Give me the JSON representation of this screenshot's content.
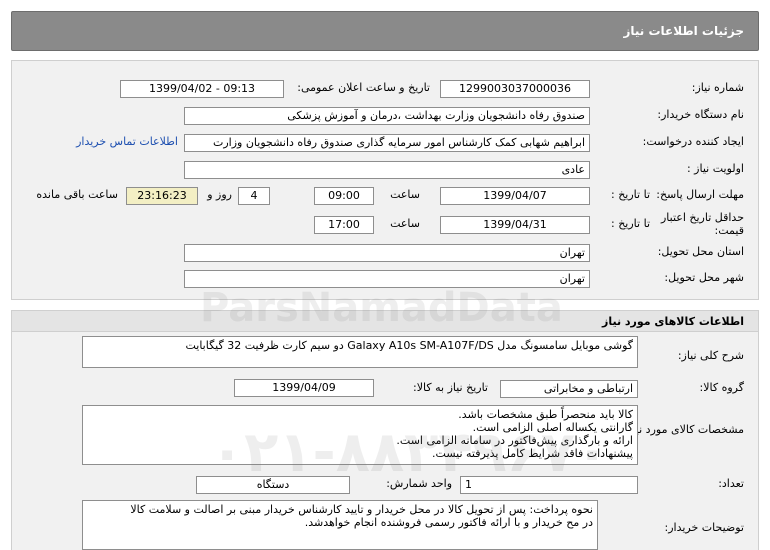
{
  "page": {
    "title": "جزئیات اطلاعات نیاز"
  },
  "need": {
    "number_label": "شماره نیاز:",
    "number": "1299003037000036",
    "announce_label": "تاریخ و ساعت اعلان عمومی:",
    "announce_value": "1399/04/02 - 09:13",
    "buyer_label": "نام دستگاه خریدار:",
    "buyer": "صندوق رفاه دانشجویان وزارت بهداشت ،درمان و آموزش پزشکی",
    "creator_label": "ایجاد کننده درخواست:",
    "creator": "ابراهیم شهابی کمک کارشناس امور سرمایه گذاری صندوق رفاه دانشجویان وزارت",
    "contact_link": "اطلاعات تماس خریدار",
    "priority_label": "اولویت نیاز :",
    "priority": "عادی",
    "deadline_label": "مهلت ارسال پاسخ:",
    "until_date_label": "تا تاریخ :",
    "deadline_date": "1399/04/07",
    "time_label": "ساعت",
    "deadline_time": "09:00",
    "days": "4",
    "days_label": "روز و",
    "remaining_time": "23:16:23",
    "remaining_label": "ساعت باقی مانده",
    "validity_label_1": "حداقل تاریخ اعتبار",
    "validity_label_2": "قیمت:",
    "validity_until_label": "تا تاریخ :",
    "validity_date": "1399/04/31",
    "validity_time_label": "ساعت",
    "validity_time": "17:00",
    "province_label": "استان محل تحویل:",
    "province": "تهران",
    "city_label": "شهر محل تحویل:",
    "city": "تهران"
  },
  "goods": {
    "header": "اطلاعات کالاهای مورد نیاز",
    "summary_label": "شرح کلی نیاز:",
    "summary": "گوشی موبایل سامسونگ مدل Galaxy A10s SM-A107F/DS دو سیم کارت ظرفیت 32 گیگابایت",
    "group_label": "گروه کالا:",
    "group": "ارتباطی و مخابراتی",
    "need_date_label": "تاریخ نیاز به کالا:",
    "need_date": "1399/04/09",
    "specs_label": "مشخصات کالای مورد نیاز:",
    "specs": [
      "کالا باید منحصراً طبق مشخصات باشد.",
      "گارانتی یکساله اصلی الزامی است.",
      "ارائه و بارگذاری پیش‌فاکتور در سامانه الزامی است.",
      "پیشنهادات فاقد شرایط کامل پذیرفته نیست."
    ],
    "quantity_label": "تعداد:",
    "quantity": "1",
    "unit_label": "واحد شمارش:",
    "unit": "دستگاه",
    "notes_label": "توضیحات خریدار:",
    "notes": [
      "نحوه پرداخت: پس از تحویل کالا در محل خریدار و تایید کارشناس خریدار مبنی بر اصالت و سلامت کالا",
      "در مح خریدار و با ارائه فاکتور رسمی فروشنده انجام خواهدشد."
    ]
  },
  "watermark": {
    "brand": "ParsNamadData",
    "phone": "۰۲۱-۸۸۳۴۹۶۷۰"
  }
}
